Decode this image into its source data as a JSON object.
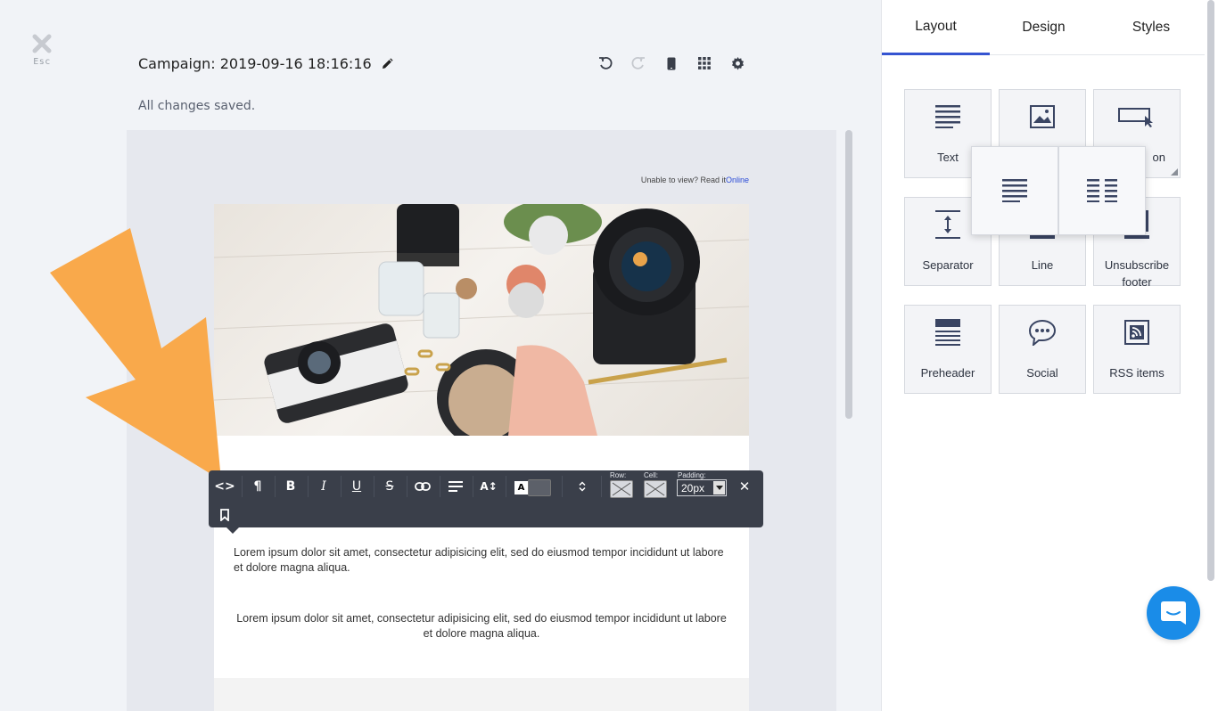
{
  "esc": {
    "label": "Esc"
  },
  "header": {
    "campaign_title": "Campaign: 2019-09-16 18:16:16",
    "save_status": "All changes saved."
  },
  "email": {
    "view_online_prefix": "Unable to view? Read it",
    "view_online_link": "Online",
    "paragraph_1": "Lorem ipsum dolor sit amet, consectetur adipisicing elit, sed do eiusmod tempor incididunt ut labore et dolore magna aliqua.",
    "paragraph_2": "Lorem ipsum dolor sit amet, consectetur adipisicing elit, sed do eiusmod tempor incididunt ut labore et dolore magna aliqua."
  },
  "toolbar": {
    "source_glyph": "<>",
    "paragraph_glyph": "¶",
    "bold_glyph": "B",
    "italic_glyph": "I",
    "underline_glyph": "U",
    "strike_glyph": "S",
    "fontsize_glyph": "A↕",
    "color_glyph": "A",
    "row_label": "Row:",
    "cell_label": "Cell:",
    "padding_label": "Padding:",
    "padding_value": "20px",
    "close_glyph": "✕"
  },
  "panel": {
    "tabs": [
      {
        "label": "Layout",
        "active": true
      },
      {
        "label": "Design",
        "active": false
      },
      {
        "label": "Styles",
        "active": false
      }
    ],
    "blocks": [
      {
        "label": "Text",
        "icon": "text-lines-icon"
      },
      {
        "label": "",
        "icon": "image-icon"
      },
      {
        "label": "on",
        "icon": "button-cursor-icon"
      },
      {
        "label": "Separator",
        "icon": "separator-icon"
      },
      {
        "label": "Line",
        "icon": "line-icon"
      },
      {
        "label": "Unsubscribe footer",
        "icon": "unsubscribe-icon"
      },
      {
        "label": "Preheader",
        "icon": "preheader-icon"
      },
      {
        "label": "Social",
        "icon": "social-chat-icon"
      },
      {
        "label": "RSS items",
        "icon": "rss-icon"
      }
    ]
  },
  "colors": {
    "accent": "#3554d1",
    "toolbar_bg": "#3a3f4a",
    "arrow": "#f9a94b",
    "chat": "#1a8ce8"
  }
}
